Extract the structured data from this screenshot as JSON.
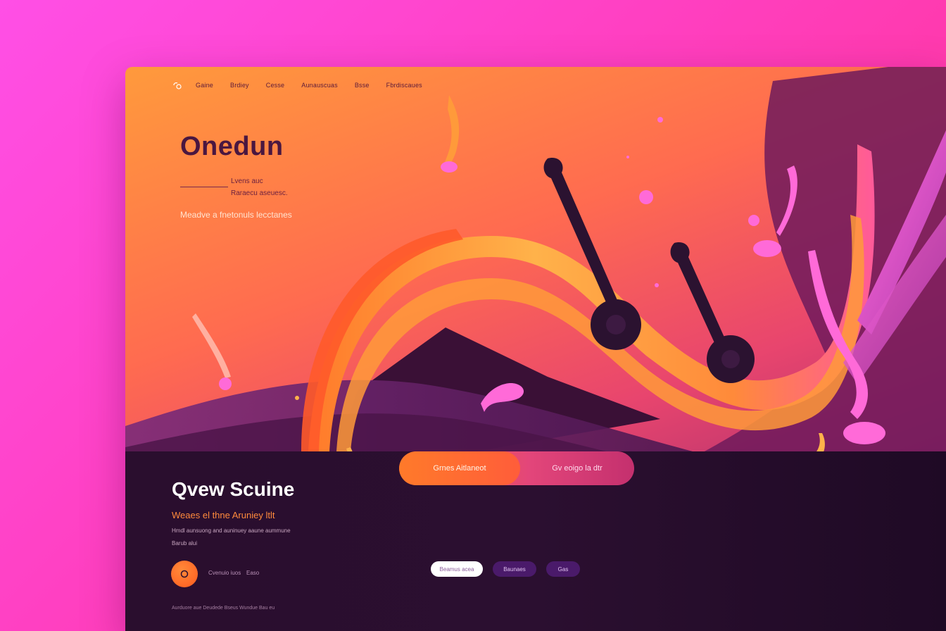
{
  "nav": {
    "items": [
      "Gaine",
      "Brdiey",
      "Cesse",
      "Aunauscuas",
      "Bsse",
      "Fbrdiscaues"
    ]
  },
  "hero": {
    "title": "Onedun",
    "small_line1": "Lvens auc",
    "small_line2": "Raraecu aseuesc.",
    "tagline": "Meadve a fnetonuls lecctanes"
  },
  "section": {
    "title": "Qvew Scuine",
    "subtitle": "Weaes el thne Aruniey ltlt",
    "desc_line1": "Hmdl aunsuong and auninuey aaune aummune",
    "desc_line2": "Barub alui",
    "footer_a": "Cvenuio iuos",
    "footer_b": "Easo",
    "footer_note": "Aurduore aue Deudede Bseus Wundue Bau eu"
  },
  "cta": {
    "primary_label": "Grnes Aitlaneot",
    "secondary_label": "Gv eoigo la dtr"
  },
  "chips": [
    "Beamus acea",
    "Baunaes",
    "Gas"
  ],
  "colors": {
    "accent_orange": "#ff7a2a",
    "accent_pink": "#e3467a",
    "panel_dark": "#2a0e2e",
    "title_plum": "#4a1740"
  },
  "icons": {
    "logo": "music-note-logo-icon",
    "round_button": "play-icon"
  }
}
